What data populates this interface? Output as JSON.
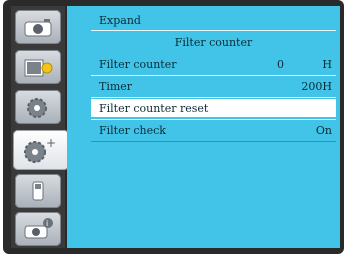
{
  "menu": {
    "title": "Expand",
    "section_heading": "Filter counter",
    "items": [
      {
        "label": "Filter counter",
        "value": "0",
        "unit": "H"
      },
      {
        "label": "Timer",
        "value": "200H"
      },
      {
        "label": "Filter counter reset",
        "value": ""
      },
      {
        "label": "Filter check",
        "value": "On"
      }
    ],
    "selected_index": 2
  },
  "sidebar": {
    "tabs": [
      {
        "icon": "camera-icon"
      },
      {
        "icon": "display-settings-icon"
      },
      {
        "icon": "settings-gear-icon"
      },
      {
        "icon": "expand-settings-icon",
        "active": true
      },
      {
        "icon": "usb-icon"
      },
      {
        "icon": "info-icon"
      }
    ]
  },
  "colors": {
    "panel_bg": "#41c4e8",
    "selected_row_bg": "#ffffff",
    "frame_bg": "#2a2a2a"
  }
}
